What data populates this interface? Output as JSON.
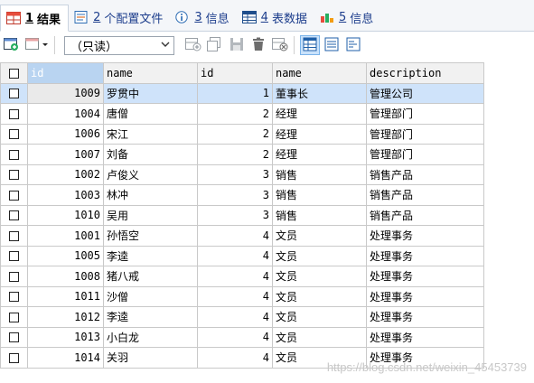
{
  "tabs": [
    {
      "num": "1",
      "label": "结果",
      "icon": "grid-results-icon",
      "active": true
    },
    {
      "num": "2",
      "label": "个配置文件",
      "icon": "profile-icon"
    },
    {
      "num": "3",
      "label": "信息",
      "icon": "info-icon"
    },
    {
      "num": "4",
      "label": "表数据",
      "icon": "table-data-icon"
    },
    {
      "num": "5",
      "label": "信息",
      "icon": "history-info-icon"
    }
  ],
  "toolbar": {
    "mode_value": "（只读）"
  },
  "table": {
    "columns": [
      "id",
      "name",
      "id",
      "name",
      "description"
    ],
    "rows": [
      [
        "1009",
        "罗贯中",
        "1",
        "董事长",
        "管理公司"
      ],
      [
        "1004",
        "唐僧",
        "2",
        "经理",
        "管理部门"
      ],
      [
        "1006",
        "宋江",
        "2",
        "经理",
        "管理部门"
      ],
      [
        "1007",
        "刘备",
        "2",
        "经理",
        "管理部门"
      ],
      [
        "1002",
        "卢俊义",
        "3",
        "销售",
        "销售产品"
      ],
      [
        "1003",
        "林冲",
        "3",
        "销售",
        "销售产品"
      ],
      [
        "1010",
        "吴用",
        "3",
        "销售",
        "销售产品"
      ],
      [
        "1001",
        "孙悟空",
        "4",
        "文员",
        "处理事务"
      ],
      [
        "1005",
        "李逵",
        "4",
        "文员",
        "处理事务"
      ],
      [
        "1008",
        "猪八戒",
        "4",
        "文员",
        "处理事务"
      ],
      [
        "1011",
        "沙僧",
        "4",
        "文员",
        "处理事务"
      ],
      [
        "1012",
        "李逵",
        "4",
        "文员",
        "处理事务"
      ],
      [
        "1013",
        "小白龙",
        "4",
        "文员",
        "处理事务"
      ],
      [
        "1014",
        "关羽",
        "4",
        "文员",
        "处理事务"
      ]
    ]
  },
  "watermark": "https://blog.csdn.net/weixin_45453739"
}
